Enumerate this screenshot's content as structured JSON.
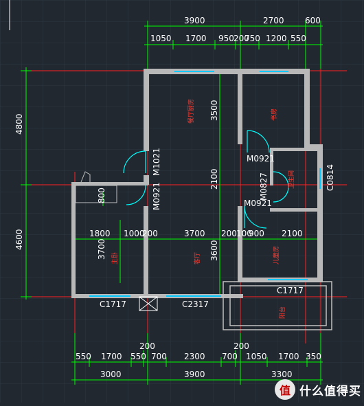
{
  "plan": {
    "top_dims_row1": [
      "3900",
      "2700",
      "600"
    ],
    "top_dims_row2": [
      "1050",
      "1700",
      "950",
      "200",
      "750",
      "1200",
      "550"
    ],
    "left_dims": [
      "4800",
      "4600"
    ],
    "bottom_dims_row1": [
      "550",
      "1700",
      "550",
      "700",
      "2300",
      "700",
      "1050",
      "1700",
      "350"
    ],
    "bottom_dims_200": [
      "200",
      "200"
    ],
    "bottom_dims_row2": [
      "3000",
      "3900",
      "3300"
    ],
    "mid_dims": [
      "1800",
      "1000",
      "200",
      "3700",
      "200",
      "100",
      "900",
      "2100"
    ],
    "inner_dims": {
      "d3500": "3500",
      "d2100": "2100",
      "d3600": "3600",
      "d3700": "3700",
      "d800": "800"
    },
    "door_tags": {
      "m1021": "M1021",
      "m0921_a": "M0921",
      "m0921_b": "M0921",
      "m0921_c": "M0921",
      "m0827": "M0827"
    },
    "window_tags": {
      "c1717_a": "C1717",
      "c2317": "C2317",
      "c1717_b": "C1717",
      "c0814": "C0814"
    },
    "room_labels": {
      "dining": "餐厅厨房",
      "bedroom_a": "书房",
      "bathroom": "卫生间",
      "bedroom_b": "主卧",
      "living": "客厅",
      "bedroom_c": "儿童房",
      "balcony": "阳台"
    }
  },
  "watermark": {
    "logo": "值",
    "text": "什么值得买"
  },
  "colors": {
    "background": "#212830",
    "wall": "#b8b8b8",
    "dim_line": "#00ff00",
    "axis": "#ff2020",
    "door": "#00ffff",
    "text": "#ffffff"
  }
}
